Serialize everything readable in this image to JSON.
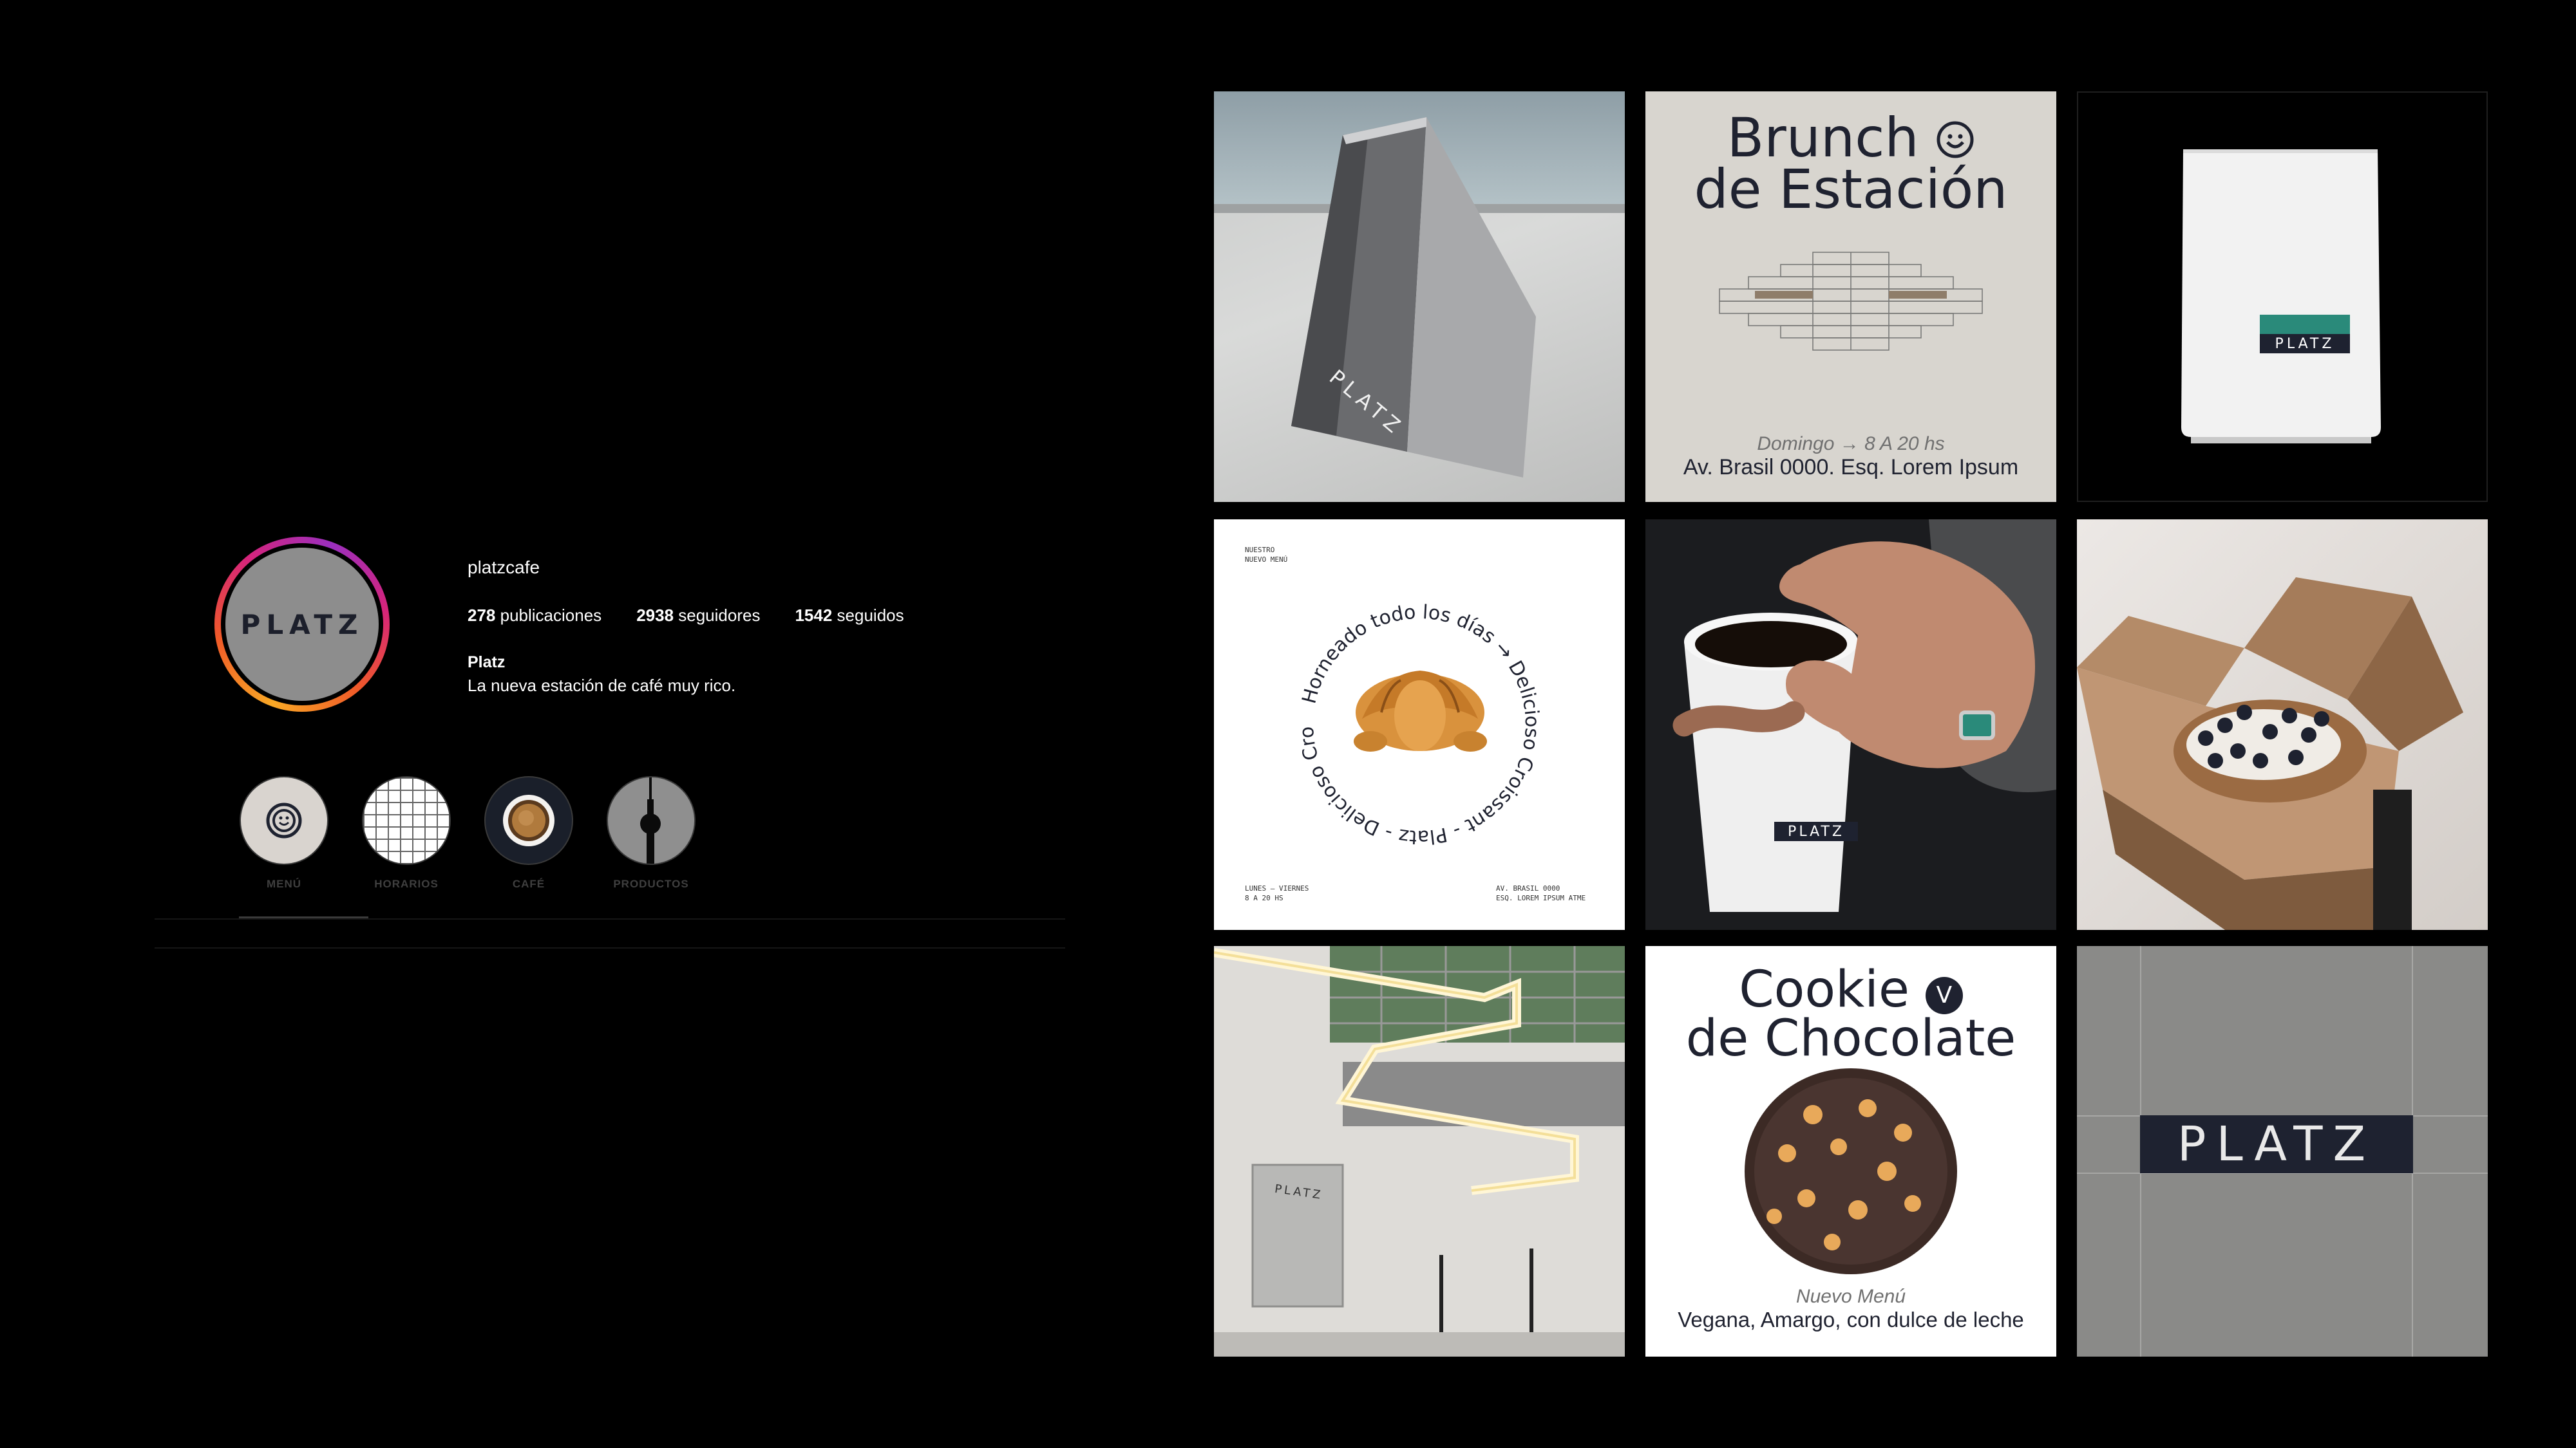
{
  "profile": {
    "username": "platzcafe",
    "avatar_text": "PLATZ",
    "stats": {
      "posts_count": "278",
      "posts_label": "publicaciones",
      "followers_count": "2938",
      "followers_label": "seguidores",
      "following_count": "1542",
      "following_label": "seguidos"
    },
    "bio_name": "Platz",
    "bio_text": "La nueva estación de café muy rico."
  },
  "highlights": [
    {
      "label": "MENÚ",
      "icon": "smiley-icon"
    },
    {
      "label": "HORARIOS",
      "icon": "grid-icon"
    },
    {
      "label": "CAFÉ",
      "icon": "coffee-cup-icon"
    },
    {
      "label": "PRODUCTOS",
      "icon": "tv-tower-icon"
    }
  ],
  "posts": {
    "sign": {
      "brand": "PLATZ"
    },
    "brunch": {
      "title_line1": "Brunch",
      "title_line2": "de Estación",
      "schedule_day": "Domingo",
      "schedule_arrow": "→",
      "schedule_hours": "8 A 20 hs",
      "address": "Av. Brasil 0000. Esq. Lorem Ipsum"
    },
    "coffee_bag": {
      "brand": "PLATZ"
    },
    "croissant": {
      "top_left_1": "NUESTRO",
      "top_left_2": "NUEVO MENÚ",
      "ring_text": "Horneado todo los días → Delicioso Croissant - Platz - Delicioso Croissant →",
      "bottom_left_1": "LUNES  —  VIERNES",
      "bottom_left_2": "8 A 20 HS",
      "bottom_right_1": "AV. BRASIL 0000",
      "bottom_right_2": "ESQ. LOREM IPSUM ATME"
    },
    "cup": {
      "brand": "PLATZ"
    },
    "box": {},
    "interior": {
      "brand": "PLATZ"
    },
    "cookie": {
      "title_line1": "Cookie",
      "badge": "V",
      "title_line2": "de Chocolate",
      "subtitle": "Nuevo Menú",
      "description": "Vegana, Amargo, con dulce de leche"
    },
    "logo": {
      "brand": "PLATZ"
    }
  },
  "colors": {
    "background": "#000000",
    "navy": "#1e2230",
    "teal": "#2a8a7a",
    "story_ring": [
      "#f9a825",
      "#f05a28",
      "#d6247a",
      "#9b2fbf"
    ]
  }
}
